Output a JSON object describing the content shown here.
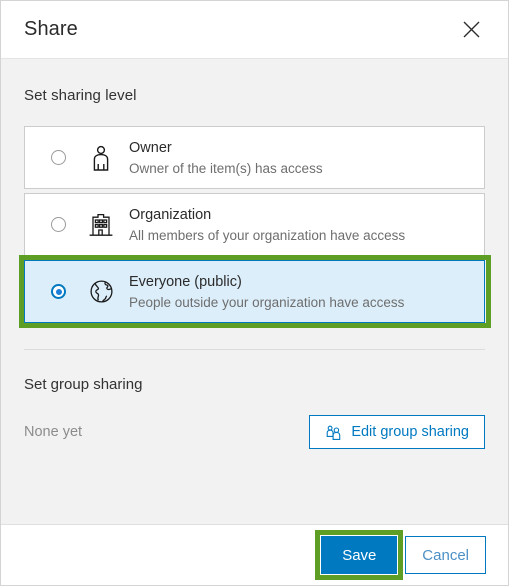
{
  "dialog": {
    "title": "Share",
    "close_icon": "close-icon"
  },
  "sharing": {
    "section_title": "Set sharing level",
    "options": [
      {
        "id": "owner",
        "label": "Owner",
        "description": "Owner of the item(s) has access",
        "icon": "person-icon",
        "selected": false
      },
      {
        "id": "organization",
        "label": "Organization",
        "description": "All members of your organization have access",
        "icon": "building-icon",
        "selected": false
      },
      {
        "id": "everyone",
        "label": "Everyone (public)",
        "description": "People outside your organization have access",
        "icon": "globe-icon",
        "selected": true
      }
    ]
  },
  "group_sharing": {
    "section_title": "Set group sharing",
    "status": "None yet",
    "edit_button_label": "Edit group sharing",
    "edit_button_icon": "group-users-icon"
  },
  "footer": {
    "save_label": "Save",
    "cancel_label": "Cancel"
  },
  "colors": {
    "accent_blue": "#0079c1",
    "highlight_green": "#5f9e25",
    "selected_row_bg": "#dceefa",
    "body_bg": "#f2f2f2"
  }
}
